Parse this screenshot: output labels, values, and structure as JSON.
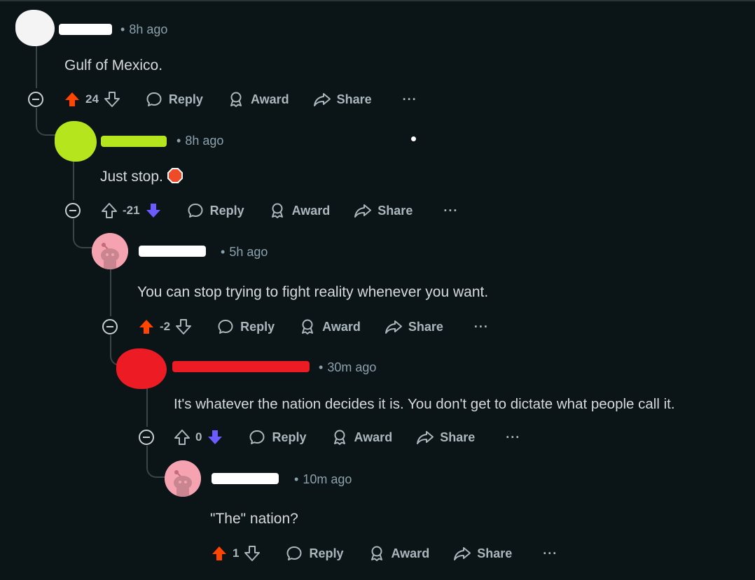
{
  "comments": [
    {
      "time": "8h ago",
      "body": "Gulf of Mexico.",
      "score": "24",
      "vote": "up",
      "avatar": "white-blob",
      "name_redaction_color": "#ffffff"
    },
    {
      "time": "8h ago",
      "body": "Just stop.",
      "score": "-21",
      "vote": "down",
      "avatar": "green-blob",
      "name_redaction_color": "#b5e61d"
    },
    {
      "time": "5h ago",
      "body": "You can stop trying to fight reality whenever you want.",
      "score": "-2",
      "vote": "up",
      "avatar": "snoo-pink",
      "name_redaction_color": "#ffffff"
    },
    {
      "time": "30m ago",
      "body": "It's whatever the nation decides it is. You don't get to dictate what people call it.",
      "score": "0",
      "vote": "down",
      "avatar": "red-blob",
      "name_redaction_color": "#ed1c24"
    },
    {
      "time": "10m ago",
      "body": "\"The\" nation?",
      "score": "1",
      "vote": "up",
      "avatar": "snoo-pink",
      "name_redaction_color": "#ffffff"
    }
  ],
  "actions": {
    "reply": "Reply",
    "award": "Award",
    "share": "Share",
    "more": "···"
  },
  "meta_separator": "•",
  "colors": {
    "background": "#0b1416",
    "upvote_active": "#ff4500",
    "downvote_active": "#6a5cff",
    "meta_text": "#8ba2ad",
    "body_text": "#d7dadc"
  },
  "icons": [
    "collapse-icon",
    "upvote-icon",
    "downvote-icon",
    "reply-icon",
    "award-icon",
    "share-icon",
    "more-icon",
    "stop-sign-icon",
    "snoo-avatar-icon"
  ]
}
